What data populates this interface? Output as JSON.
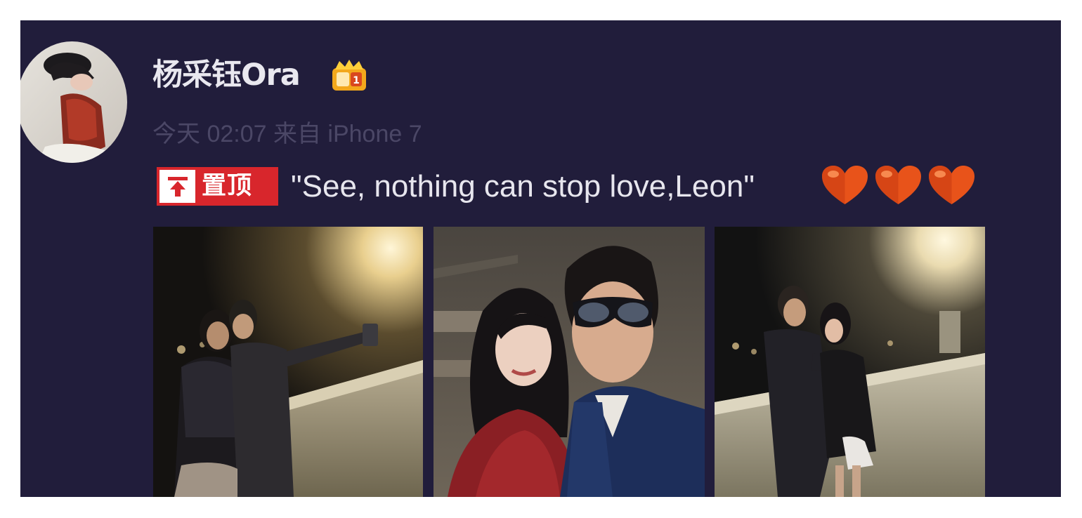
{
  "post": {
    "username": "杨采钰Ora",
    "meta": "今天 02:07 来自 iPhone 7",
    "pin_label": "置顶",
    "text": "\"See, nothing can stop love,Leon\""
  },
  "icons": {
    "vip_badge": "vip-crown-badge-icon",
    "pin": "pin-to-top-icon",
    "heart": "heart-emoji-icon"
  },
  "colors": {
    "card_background": "#211d3b",
    "pin_tag": "#d8262c",
    "meta_text": "#4b4766",
    "heart": "#e8531a"
  },
  "photos": [
    {
      "description": "couple-taking-selfie-at-night"
    },
    {
      "description": "couple-close-up-selfie"
    },
    {
      "description": "couple-embracing-at-night"
    }
  ]
}
